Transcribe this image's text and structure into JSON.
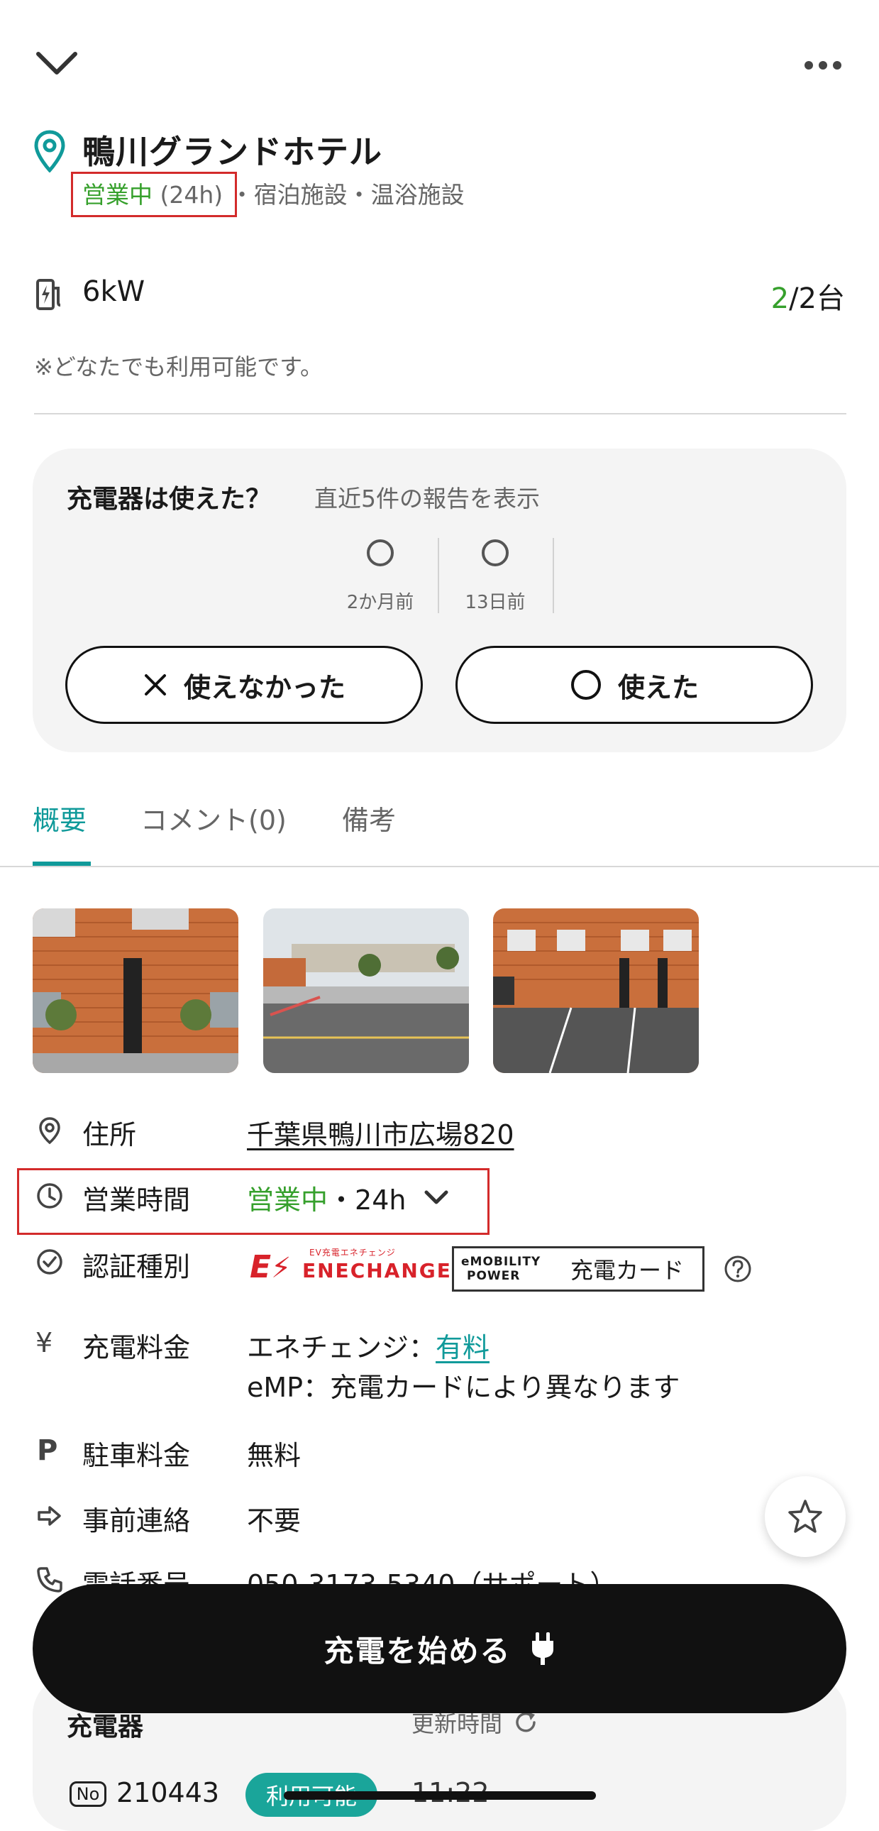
{
  "header": {
    "title": "鴨川グランドホテル",
    "status_open": "営業中",
    "status_hours": "(24h)",
    "categories": "・宿泊施設・温浴施設"
  },
  "charger_summary": {
    "power": "6kW",
    "available": "2",
    "total": "/2台",
    "note": "※どなたでも利用可能です。"
  },
  "report": {
    "question": "充電器は使えた？",
    "subtitle": "直近5件の報告を表示",
    "entries": [
      "2か月前",
      "13日前"
    ],
    "fail_label": "使えなかった",
    "ok_label": "使えた"
  },
  "tabs": [
    {
      "label": "概要",
      "active": true
    },
    {
      "label": "コメント(0)",
      "active": false
    },
    {
      "label": "備考",
      "active": false
    }
  ],
  "info": {
    "address_label": "住所",
    "address_value": "千葉県鴨川市広場820",
    "hours_label": "営業時間",
    "hours_open": "営業中",
    "hours_value": "・24h",
    "auth_label": "認証種別",
    "ene_small": "EV充電エネチェンジ",
    "ene_name": "ENECHANGE",
    "emp_brand_1": "eMOBILITY",
    "emp_brand_2": "POWER",
    "emp_card": "充電カード",
    "fee_label": "充電料金",
    "fee_line1_prefix": "エネチェンジ：",
    "fee_line1_link": "有料",
    "fee_line2": "eMP：充電カードにより異なります",
    "parking_label": "駐車料金",
    "parking_value": "無料",
    "contact_label": "事前連絡",
    "contact_value": "不要",
    "phone_label": "電話番号",
    "phone_value": "050-3173-5340（サポート）"
  },
  "bottom": {
    "start_label": "充電を始める",
    "charger_heading": "充電器",
    "updated_label": "更新時間",
    "no_badge": "No",
    "charger_no": "210443",
    "availability": "利用可能",
    "time": "11:22"
  },
  "colors": {
    "accent_teal": "#109a9a",
    "open_green": "#36a02c",
    "highlight_red": "#d32b2b",
    "button_black": "#111111"
  }
}
